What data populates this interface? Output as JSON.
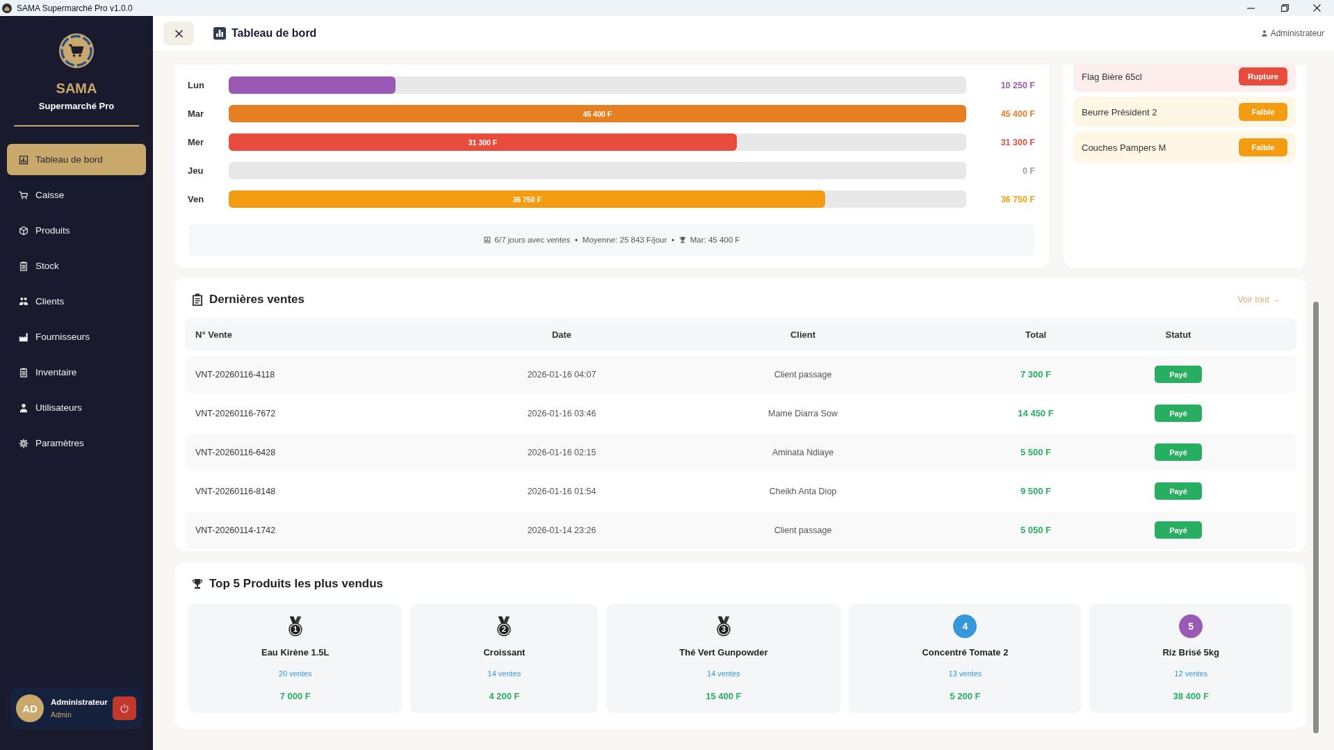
{
  "window": {
    "title": "SAMA Supermarché Pro v1.0.0"
  },
  "sidebar": {
    "brand": "SAMA",
    "subtitle": "Supermarché Pro",
    "items": [
      {
        "label": "Tableau de bord",
        "selected": true
      },
      {
        "label": "Caisse",
        "selected": false
      },
      {
        "label": "Produits",
        "selected": false
      },
      {
        "label": "Stock",
        "selected": false
      },
      {
        "label": "Clients",
        "selected": false
      },
      {
        "label": "Fournisseurs",
        "selected": false
      },
      {
        "label": "Inventaire",
        "selected": false
      },
      {
        "label": "Utilisateurs",
        "selected": false
      },
      {
        "label": "Paramètres",
        "selected": false
      }
    ],
    "user": {
      "initials": "AD",
      "name": "Administrateur",
      "role": "Admin"
    }
  },
  "header": {
    "title": "Tableau de bord",
    "user": "Administrateur"
  },
  "sales_week": {
    "rows": [
      {
        "day": "Lun",
        "level": 0.226,
        "value": "10 250 F",
        "color": "#9b59b6"
      },
      {
        "day": "Mar",
        "level": 1,
        "bar_label": "45 400 F",
        "value": "45 400 F",
        "color": "#e67e22"
      },
      {
        "day": "Mer",
        "level": 0.689,
        "bar_label": "31 300 F",
        "value": "31 300 F",
        "color": "#e74c3c"
      },
      {
        "day": "Jeu",
        "value": "0 F",
        "color": "#95a5a6"
      },
      {
        "day": "Ven",
        "level": 0.809,
        "bar_label": "36 750 F",
        "value": "36 750 F",
        "color": "#f39c12"
      }
    ],
    "summary": [
      {
        "kind": "stat",
        "text": "6/7 jours avec ventes"
      },
      {
        "kind": "separator",
        "text": "•"
      },
      {
        "kind": "stat",
        "text": "Moyenne: 25 843 F/jour"
      },
      {
        "kind": "separator",
        "text": "•"
      },
      {
        "kind": "stat",
        "text": "Mar: 45 400 F"
      }
    ]
  },
  "stock_alerts": [
    {
      "name": "Flag Bière 65cl",
      "status": "Rupture",
      "kind": "out"
    },
    {
      "name": "Beurre Président 2",
      "status": "Faible",
      "kind": "low"
    },
    {
      "name": "Couches Pampers M",
      "status": "Faible",
      "kind": "low"
    }
  ],
  "recent_sales": {
    "title": "Dernières ventes",
    "link": "Voir tout →",
    "columns": [
      "N° Vente",
      "Date",
      "Client",
      "Total",
      "Statut"
    ],
    "rows": [
      {
        "number": "VNT-20260116-4118",
        "date": "2026-01-16 04:07",
        "client": "Client passage",
        "total": "7 300 F",
        "status": "Payé"
      },
      {
        "number": "VNT-20260116-7672",
        "date": "2026-01-16 03:46",
        "client": "Mame Diarra Sow",
        "total": "14 450 F",
        "status": "Payé"
      },
      {
        "number": "VNT-20260116-6428",
        "date": "2026-01-16 02:15",
        "client": "Aminata Ndiaye",
        "total": "5 500 F",
        "status": "Payé"
      },
      {
        "number": "VNT-20260116-8148",
        "date": "2026-01-16 01:54",
        "client": "Cheikh Anta Diop",
        "total": "9 500 F",
        "status": "Payé"
      },
      {
        "number": "VNT-20260114-1742",
        "date": "2026-01-14 23:26",
        "client": "Client passage",
        "total": "5 050 F",
        "status": "Payé"
      }
    ]
  },
  "top_products": {
    "title": "Top 5 Produits les plus vendus",
    "items": [
      {
        "kind": "medal",
        "rank": "1",
        "name": "Eau Kirène 1.5L",
        "sales": "20 ventes",
        "amount": "7 000 F"
      },
      {
        "kind": "medal",
        "rank": "2",
        "name": "Croissant",
        "sales": "14 ventes",
        "amount": "4 200 F"
      },
      {
        "kind": "medal",
        "rank": "3",
        "name": "Thé Vert Gunpowder",
        "sales": "14 ventes",
        "amount": "15 400 F"
      },
      {
        "kind": "circle",
        "rank": "4",
        "color": "#3498db",
        "name": "Concentré Tomate 2",
        "sales": "13 ventes",
        "amount": "5 200 F"
      },
      {
        "kind": "circle",
        "rank": "5",
        "color": "#9b59b6",
        "name": "Riz Brisé 5kg",
        "sales": "12 ventes",
        "amount": "38 400 F"
      }
    ]
  }
}
